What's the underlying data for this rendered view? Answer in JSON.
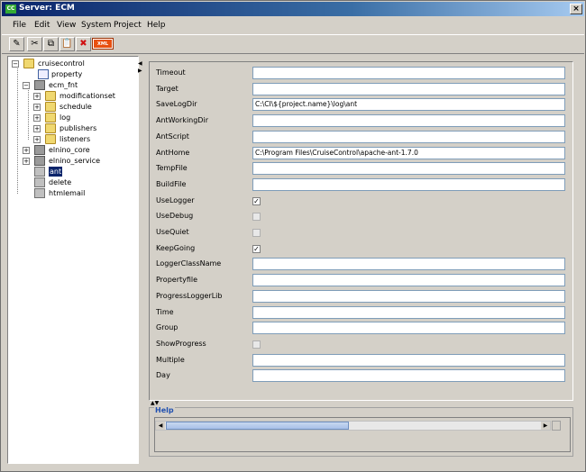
{
  "window": {
    "title": "Server: ECM",
    "app_icon": "CC"
  },
  "menu": [
    "File",
    "Edit",
    "View",
    "System",
    "Project",
    "Help"
  ],
  "toolbar": {
    "xml_label": "XML"
  },
  "tree": {
    "root": "cruisecontrol",
    "property": "property",
    "ecm_fnt": "ecm_fnt",
    "children": [
      "modificationset",
      "schedule",
      "log",
      "publishers",
      "listeners"
    ],
    "elnino_core": "elnino_core",
    "elnino_service": "elnino_service",
    "ant": "ant",
    "delete": "delete",
    "htmlemail": "htmlemail"
  },
  "form": {
    "fields": [
      {
        "label": "Timeout",
        "type": "text",
        "value": ""
      },
      {
        "label": "Target",
        "type": "text",
        "value": ""
      },
      {
        "label": "SaveLogDir",
        "type": "text",
        "value": "C:\\CI\\${project.name}\\log\\ant"
      },
      {
        "label": "AntWorkingDir",
        "type": "text",
        "value": ""
      },
      {
        "label": "AntScript",
        "type": "text",
        "value": ""
      },
      {
        "label": "AntHome",
        "type": "text",
        "value": "C:\\Program Files\\CruiseControl\\apache-ant-1.7.0"
      },
      {
        "label": "TempFile",
        "type": "text",
        "value": ""
      },
      {
        "label": "BuildFile",
        "type": "text",
        "value": ""
      },
      {
        "label": "UseLogger",
        "type": "checkbox",
        "checked": true
      },
      {
        "label": "UseDebug",
        "type": "checkbox",
        "checked": false
      },
      {
        "label": "UseQuiet",
        "type": "checkbox",
        "checked": false
      },
      {
        "label": "KeepGoing",
        "type": "checkbox",
        "checked": true
      },
      {
        "label": "LoggerClassName",
        "type": "text",
        "value": ""
      },
      {
        "label": "Propertyfile",
        "type": "text",
        "value": ""
      },
      {
        "label": "ProgressLoggerLib",
        "type": "text",
        "value": ""
      },
      {
        "label": "Time",
        "type": "text",
        "value": ""
      },
      {
        "label": "Group",
        "type": "text",
        "value": ""
      },
      {
        "label": "ShowProgress",
        "type": "checkbox",
        "checked": false
      },
      {
        "label": "Multiple",
        "type": "text",
        "value": ""
      },
      {
        "label": "Day",
        "type": "text",
        "value": ""
      }
    ]
  },
  "help": {
    "title": "Help"
  }
}
